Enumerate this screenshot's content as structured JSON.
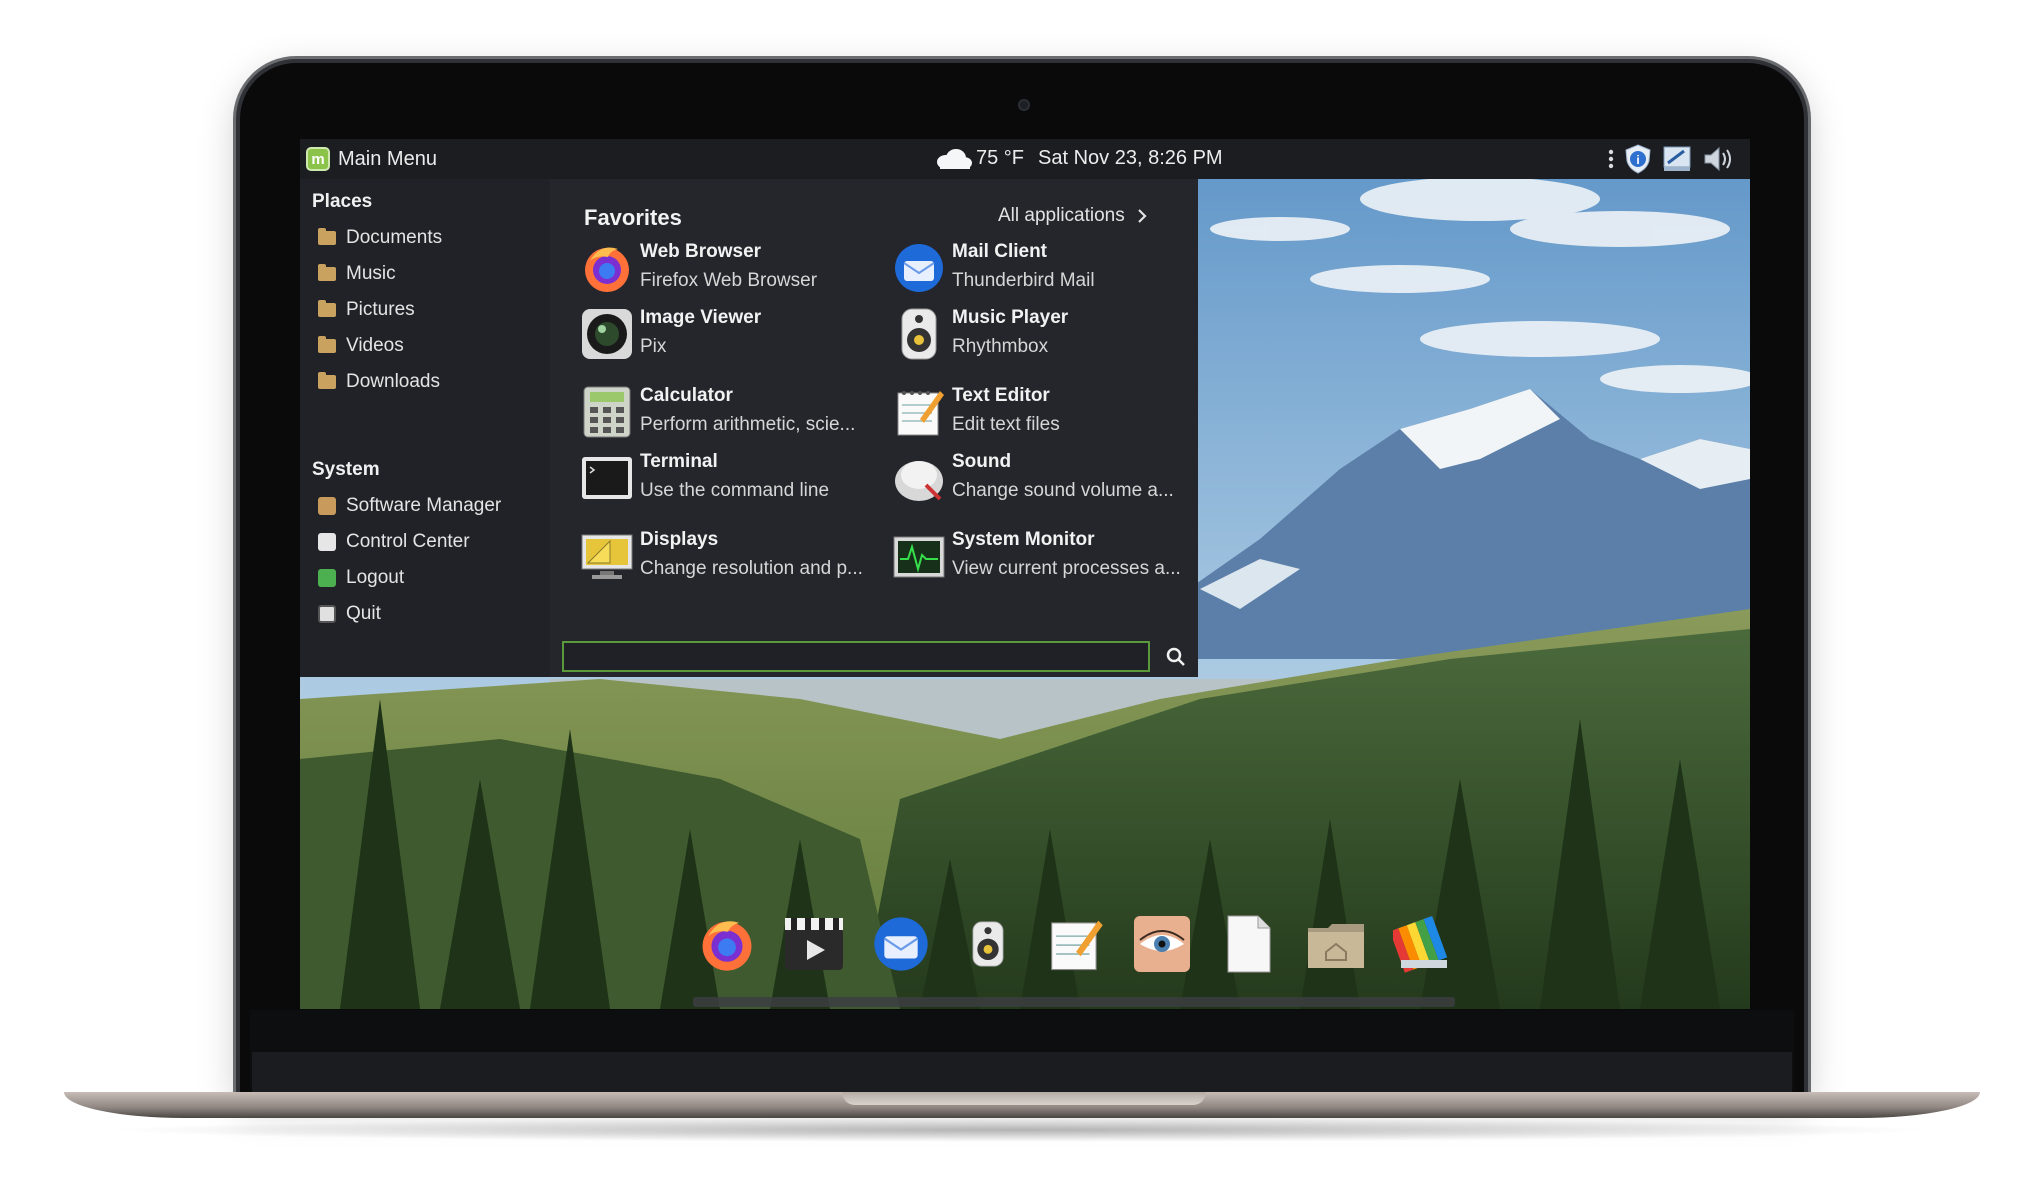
{
  "panel": {
    "menu_label": "Main Menu",
    "weather_temp": "75 °F",
    "datetime": "Sat Nov 23,  8:26 PM",
    "tray_icons": [
      "more-icon",
      "shield-icon",
      "network-icon",
      "volume-icon"
    ]
  },
  "menu": {
    "places_title": "Places",
    "places": [
      "Documents",
      "Music",
      "Pictures",
      "Videos",
      "Downloads"
    ],
    "system_title": "System",
    "system": [
      "Software Manager",
      "Control Center",
      "Logout",
      "Quit"
    ],
    "favorites_title": "Favorites",
    "all_applications": "All applications",
    "apps": [
      {
        "name": "Web Browser",
        "desc": "Firefox Web Browser",
        "icon": "firefox-icon"
      },
      {
        "name": "Mail Client",
        "desc": "Thunderbird Mail",
        "icon": "thunderbird-icon"
      },
      {
        "name": "Image Viewer",
        "desc": "Pix",
        "icon": "camera-lens-icon"
      },
      {
        "name": "Music Player",
        "desc": "Rhythmbox",
        "icon": "speaker-icon"
      },
      {
        "name": "Calculator",
        "desc": "Perform arithmetic, scie...",
        "icon": "calculator-icon"
      },
      {
        "name": "Text Editor",
        "desc": "Edit text files",
        "icon": "notepad-icon"
      },
      {
        "name": "Terminal",
        "desc": "Use the command line",
        "icon": "terminal-icon"
      },
      {
        "name": "Sound",
        "desc": "Change sound volume a...",
        "icon": "sound-icon"
      },
      {
        "name": "Displays",
        "desc": "Change resolution and p...",
        "icon": "displays-icon"
      },
      {
        "name": "System Monitor",
        "desc": "View current processes a...",
        "icon": "system-monitor-icon"
      }
    ],
    "search_value": "",
    "colors": {
      "accent": "#5a9a3a",
      "menu_bg": "#24262c",
      "panel_bg": "#1c1d21"
    }
  },
  "dock": [
    "firefox-icon",
    "video-player-icon",
    "thunderbird-icon",
    "speaker-icon",
    "text-editor-icon",
    "eye-icon",
    "blank-document-icon",
    "home-folder-icon",
    "color-palette-icon"
  ]
}
